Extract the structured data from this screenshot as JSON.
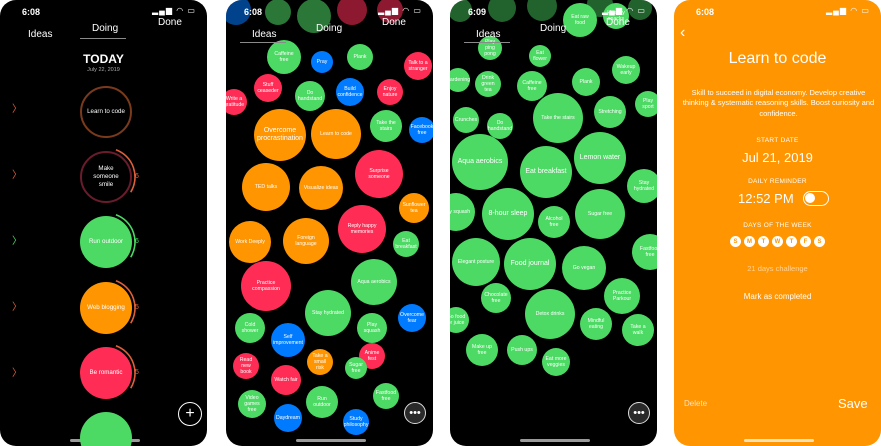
{
  "colors": {
    "green": "#4CD964",
    "orange": "#FF9500",
    "pink": "#FF2D55",
    "blue": "#007AFF",
    "ring_dark": "#1a1a1a"
  },
  "screen1": {
    "status_time": "6:08",
    "nav": {
      "ideas": "Ideas",
      "doing": "Doing",
      "done": "Done"
    },
    "title": "TODAY",
    "date": "July 22, 2019",
    "rings": [
      {
        "label": "Learn to code",
        "fill": "dark",
        "count": ""
      },
      {
        "label": "Make someone smile",
        "fill": "dark",
        "count": "6"
      },
      {
        "label": "Run outdoor",
        "fill": "green",
        "count": "6"
      },
      {
        "label": "Web blogging",
        "fill": "orange",
        "count": "5"
      },
      {
        "label": "Be romantic",
        "fill": "pink",
        "count": "5"
      },
      {
        "label": "",
        "fill": "green",
        "count": ""
      }
    ],
    "plus_icon": "plus-icon"
  },
  "screen2": {
    "status_time": "6:08",
    "nav": {
      "ideas": "Ideas",
      "doing": "Doing",
      "done": "Done"
    },
    "bubbles": [
      {
        "label": "Caffeine free",
        "color": "green"
      },
      {
        "label": "Pray",
        "color": "blue"
      },
      {
        "label": "Plank",
        "color": "green"
      },
      {
        "label": "Talk to a stranger",
        "color": "pink"
      },
      {
        "label": "Stuff ceaseder",
        "color": "pink"
      },
      {
        "label": "Do handstand",
        "color": "green"
      },
      {
        "label": "Build confidence",
        "color": "blue"
      },
      {
        "label": "Enjoy nature",
        "color": "pink"
      },
      {
        "label": "Write a gratitude",
        "color": "pink"
      },
      {
        "label": "Overcome procrastination",
        "color": "orange"
      },
      {
        "label": "Learn to code",
        "color": "orange"
      },
      {
        "label": "Take the stairs",
        "color": "green"
      },
      {
        "label": "Facebook free",
        "color": "blue"
      },
      {
        "label": "TED talks",
        "color": "orange"
      },
      {
        "label": "Visualize ideas",
        "color": "orange"
      },
      {
        "label": "Surprise someone",
        "color": "pink"
      },
      {
        "label": "Sunflower tea",
        "color": "orange"
      },
      {
        "label": "Work Deeply",
        "color": "orange"
      },
      {
        "label": "Foreign language",
        "color": "orange"
      },
      {
        "label": "Reply happy memories",
        "color": "pink"
      },
      {
        "label": "Eat breakfast",
        "color": "green"
      },
      {
        "label": "Practice compassion",
        "color": "pink"
      },
      {
        "label": "Aqua aerobics",
        "color": "green"
      },
      {
        "label": "Stay hydrated",
        "color": "green"
      },
      {
        "label": "Cold shower",
        "color": "green"
      },
      {
        "label": "Play squash",
        "color": "green"
      },
      {
        "label": "Overcome fear",
        "color": "blue"
      },
      {
        "label": "Self improvement",
        "color": "blue"
      },
      {
        "label": "Take a small risk",
        "color": "orange"
      },
      {
        "label": "Anime fest",
        "color": "pink"
      },
      {
        "label": "Read new book",
        "color": "pink"
      },
      {
        "label": "Sugar free",
        "color": "green"
      },
      {
        "label": "Watch fair",
        "color": "pink"
      },
      {
        "label": "Video games free",
        "color": "green"
      },
      {
        "label": "Run outdoor",
        "color": "green"
      },
      {
        "label": "Fastfood free",
        "color": "green"
      },
      {
        "label": "Daydream",
        "color": "blue"
      },
      {
        "label": "Study philosophy",
        "color": "blue"
      }
    ],
    "more_icon": "more-icon"
  },
  "screen3": {
    "status_time": "6:09",
    "nav": {
      "ideas": "Ideas",
      "doing": "Doing",
      "done": "Done"
    },
    "bubbles": [
      {
        "label": "Play ping pong"
      },
      {
        "label": "Eat flower"
      },
      {
        "label": "Eat raw food"
      },
      {
        "label": "Healthy snacks"
      },
      {
        "label": "Gardening"
      },
      {
        "label": "Drink green tea"
      },
      {
        "label": "Caffeine free"
      },
      {
        "label": "Plank"
      },
      {
        "label": "Wakeup early"
      },
      {
        "label": "Crunches"
      },
      {
        "label": "Do handstand"
      },
      {
        "label": "Take the stairs"
      },
      {
        "label": "Stretching"
      },
      {
        "label": "Play sport"
      },
      {
        "label": "Aqua aerobics"
      },
      {
        "label": "Eat breakfast"
      },
      {
        "label": "Lemon water"
      },
      {
        "label": "Stay hydrated"
      },
      {
        "label": "Play squash"
      },
      {
        "label": "8-hour sleep"
      },
      {
        "label": "Alcohol free"
      },
      {
        "label": "Sugar free"
      },
      {
        "label": "Fastfood free"
      },
      {
        "label": "Elegant posture"
      },
      {
        "label": "Food journal"
      },
      {
        "label": "Go vegan"
      },
      {
        "label": "Chocolate free"
      },
      {
        "label": "Detox drinks"
      },
      {
        "label": "Practice Parkour"
      },
      {
        "label": "Go food or juice"
      },
      {
        "label": "Mindful eating"
      },
      {
        "label": "Take a walk"
      },
      {
        "label": "Make up free"
      },
      {
        "label": "Push ups"
      },
      {
        "label": "Eat more veggies"
      }
    ],
    "more_icon": "more-icon"
  },
  "screen4": {
    "status_time": "6:08",
    "back_icon": "chevron-left-icon",
    "title": "Learn to code",
    "description": "Skill to succeed in digital economy. Develop creative thinking & systematic reasoning skills. Boost curiosity and confidence.",
    "start_date_label": "START DATE",
    "start_date": "Jul 21, 2019",
    "daily_reminder_label": "DAILY REMINDER",
    "reminder_time": "12:52 PM",
    "days_label": "DAYS OF THE WEEK",
    "days": [
      "S",
      "M",
      "T",
      "W",
      "T",
      "F",
      "S"
    ],
    "challenge": "21 days challenge",
    "mark_completed": "Mark as completed",
    "delete": "Delete",
    "save": "Save"
  }
}
